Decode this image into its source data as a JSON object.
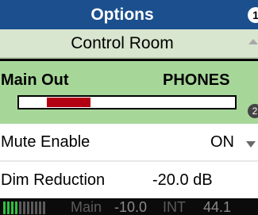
{
  "header": {
    "title": "Options",
    "badge_glyph": "1"
  },
  "control_room": {
    "label": "Control Room",
    "icon": "chevron-up-icon"
  },
  "output": {
    "label": "Main Out",
    "destination": "PHONES",
    "meter": {
      "fill_start_fraction": 0.13,
      "fill_end_fraction": 0.33,
      "fill_color": "#b30012"
    },
    "knob_glyph": "2"
  },
  "settings": [
    {
      "name": "Mute Enable",
      "value": "ON",
      "has_dropdown": true
    },
    {
      "name": "Dim Reduction",
      "value": "-20.0 dB",
      "has_dropdown": false
    }
  ],
  "status": {
    "meter_bars": {
      "total": 11,
      "active": 4,
      "active_color": "#30c040"
    },
    "source": "Main",
    "level": "-10.0",
    "clock": "INT",
    "rate": "44.1"
  },
  "colors": {
    "title_bg": "#1b4f8e",
    "selected_bg": "#a6d799",
    "header_row_bg": "#d9e6cf"
  }
}
